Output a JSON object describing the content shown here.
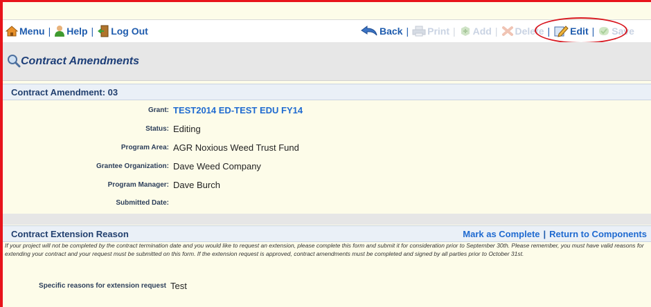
{
  "toolbar": {
    "left": [
      {
        "label": "Menu",
        "icon": "home-icon"
      },
      {
        "label": "Help",
        "icon": "help-person-icon"
      },
      {
        "label": "Log Out",
        "icon": "logout-door-icon"
      }
    ],
    "right": [
      {
        "label": "Back",
        "icon": "back-arrow-icon",
        "enabled": true
      },
      {
        "label": "Print",
        "icon": "printer-icon",
        "enabled": false
      },
      {
        "label": "Add",
        "icon": "add-icon",
        "enabled": false
      },
      {
        "label": "Delete",
        "icon": "delete-icon",
        "enabled": false
      },
      {
        "label": "Edit",
        "icon": "edit-icon",
        "enabled": true
      },
      {
        "label": "Save",
        "icon": "save-icon",
        "enabled": false
      }
    ]
  },
  "page": {
    "title": "Contract Amendments"
  },
  "amendment": {
    "heading": "Contract Amendment: 03",
    "fields": [
      {
        "label": "Grant:",
        "value": "TEST2014 ED-TEST EDU FY14"
      },
      {
        "label": "Status:",
        "value": "Editing"
      },
      {
        "label": "Program Area:",
        "value": "AGR Noxious Weed Trust Fund"
      },
      {
        "label": "Grantee Organization:",
        "value": "Dave Weed Company"
      },
      {
        "label": "Program Manager:",
        "value": "Dave Burch"
      },
      {
        "label": "Submitted Date:",
        "value": ""
      }
    ]
  },
  "extension": {
    "heading": "Contract Extension Reason",
    "mark_complete": "Mark as Complete",
    "return_components": "Return to Components",
    "instructions": "If your project will not be completed by the contract termination date and you would like to request an extension, please complete this form and submit it for consideration prior to September 30th. Please remember, you must have valid reasons for extending your contract and your request must be submitted on this form. If the extension request is approved, contract amendments must be completed and signed by all parties prior to October 31st.",
    "reason_label": "Specific reasons for extension request",
    "reason_value": "Test"
  },
  "colors": {
    "frame_red": "#e8141b",
    "link_blue": "#1f6ad0",
    "page_bg": "#fdfce9",
    "header_navy": "#1d3e78"
  }
}
